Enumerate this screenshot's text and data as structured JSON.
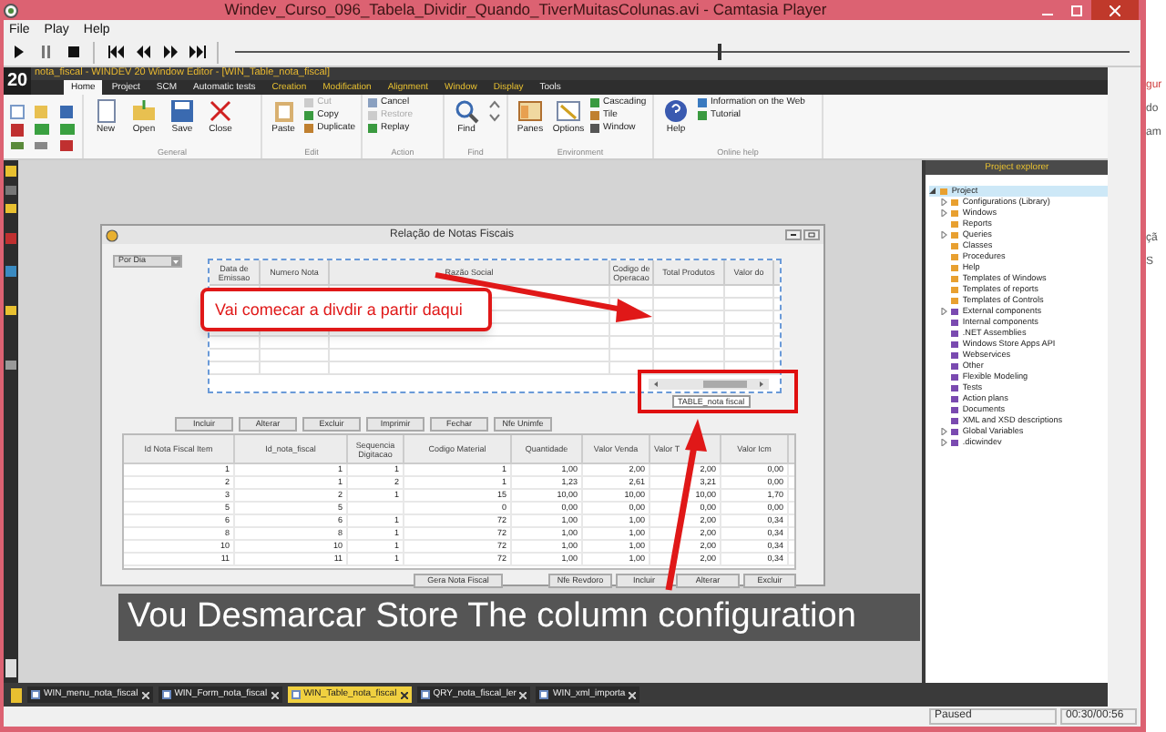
{
  "player": {
    "title": "Windev_Curso_096_Tabela_Dividir_Quando_TiverMuitasColunas.avi - Camtasia Player",
    "menu": [
      "File",
      "Play",
      "Help"
    ],
    "seek": {
      "level": 0.54
    },
    "status": "Paused",
    "time": "00:30/00:56"
  },
  "windev": {
    "logo": "20",
    "title": "nota_fiscal - WINDEV 20  Window Editor - [WIN_Table_nota_fiscal]",
    "tabs": [
      {
        "label": "Home",
        "selected": true,
        "kind": "standard"
      },
      {
        "label": "Project",
        "selected": false,
        "kind": "standard"
      },
      {
        "label": "SCM",
        "selected": false,
        "kind": "standard"
      },
      {
        "label": "Automatic tests",
        "selected": false,
        "kind": "standard"
      },
      {
        "label": "Creation",
        "selected": false,
        "kind": "contextual"
      },
      {
        "label": "Modification",
        "selected": false,
        "kind": "contextual"
      },
      {
        "label": "Alignment",
        "selected": false,
        "kind": "contextual"
      },
      {
        "label": "Window",
        "selected": false,
        "kind": "contextual"
      },
      {
        "label": "Display",
        "selected": false,
        "kind": "contextual"
      },
      {
        "label": "Tools",
        "selected": false,
        "kind": "standard"
      }
    ],
    "ribbon": [
      {
        "group": "General",
        "buttons": [
          {
            "label": "New",
            "kind": "large",
            "disabled": false
          },
          {
            "label": "Open",
            "kind": "large",
            "disabled": false
          },
          {
            "label": "Save",
            "kind": "large",
            "disabled": false
          },
          {
            "label": "Close",
            "kind": "large",
            "disabled": false
          }
        ]
      },
      {
        "group": "Edit",
        "buttons": [
          {
            "label": "Paste",
            "kind": "large",
            "disabled": false
          },
          {
            "label": "Cut",
            "kind": "small",
            "disabled": true
          },
          {
            "label": "Copy",
            "kind": "small",
            "disabled": false
          },
          {
            "label": "Duplicate",
            "kind": "small",
            "disabled": false
          }
        ]
      },
      {
        "group": "Action",
        "buttons": [
          {
            "label": "Cancel",
            "kind": "small",
            "disabled": false
          },
          {
            "label": "Restore",
            "kind": "small",
            "disabled": true
          },
          {
            "label": "Replay",
            "kind": "small",
            "disabled": false
          }
        ]
      },
      {
        "group": "Find",
        "buttons": [
          {
            "label": "Find",
            "kind": "large",
            "disabled": false
          }
        ]
      },
      {
        "group": "Environment",
        "buttons": [
          {
            "label": "Panes",
            "kind": "large",
            "disabled": false
          },
          {
            "label": "Options",
            "kind": "large",
            "disabled": false
          },
          {
            "label": "Cascading",
            "kind": "small",
            "disabled": false
          },
          {
            "label": "Tile",
            "kind": "small",
            "disabled": false
          },
          {
            "label": "Window",
            "kind": "small",
            "disabled": false
          }
        ]
      },
      {
        "group": "Online help",
        "buttons": [
          {
            "label": "Help",
            "kind": "large",
            "disabled": false
          },
          {
            "label": "Information on the Web",
            "kind": "small",
            "disabled": false
          },
          {
            "label": "Tutorial",
            "kind": "small",
            "disabled": false
          }
        ]
      }
    ],
    "explorer": {
      "title": "Project explorer",
      "tree": [
        {
          "label": "Project",
          "selected": true,
          "expanded": true,
          "children": [
            {
              "label": "Configurations (Library)",
              "collapsed": true
            },
            {
              "label": "Windows",
              "collapsed": true
            },
            {
              "label": "Reports",
              "collapsed": false
            },
            {
              "label": "Queries",
              "collapsed": true
            },
            {
              "label": "Classes",
              "collapsed": false
            },
            {
              "label": "Procedures",
              "collapsed": false
            },
            {
              "label": "Help",
              "collapsed": false
            },
            {
              "label": "Templates of Windows",
              "collapsed": false
            },
            {
              "label": "Templates of reports",
              "collapsed": false
            },
            {
              "label": "Templates of Controls",
              "collapsed": false
            },
            {
              "label": "External components",
              "collapsed": true
            },
            {
              "label": "Internal components",
              "collapsed": false
            },
            {
              "label": ".NET Assemblies",
              "collapsed": false
            },
            {
              "label": "Windows Store Apps API",
              "collapsed": false
            },
            {
              "label": "Webservices",
              "collapsed": false
            },
            {
              "label": "Other",
              "collapsed": false
            },
            {
              "label": "Flexible Modeling",
              "collapsed": false
            },
            {
              "label": "Tests",
              "collapsed": false
            },
            {
              "label": "Action plans",
              "collapsed": false
            },
            {
              "label": "Documents",
              "collapsed": false
            },
            {
              "label": "XML and XSD descriptions",
              "collapsed": false
            },
            {
              "label": "Global Variables",
              "collapsed": true
            },
            {
              "label": ".dicwindev",
              "collapsed": true
            }
          ]
        }
      ]
    },
    "editor_window": {
      "title": "Relação de Notas Fiscais",
      "combo": "Por Dia",
      "top_table": {
        "columns": [
          "Data de Emissao",
          "Numero Nota",
          "Razão Social",
          "Codigo de Operacao",
          "Total Produtos",
          "Valor do"
        ]
      },
      "buttons": [
        "Incluir",
        "Alterar",
        "Excluir",
        "Imprimir",
        "Fechar",
        "Nfe Unimfe"
      ],
      "bottom_table": {
        "columns": [
          "Id Nota Fiscal Item",
          "Id_nota_fiscal",
          "Sequencia Digitacao",
          "Codigo Material",
          "Quantidade",
          "Valor Venda",
          "Valor T",
          "Valor Icm"
        ],
        "rows": [
          [
            "1",
            "1",
            "1",
            "1",
            "1,00",
            "2,00",
            "2,00",
            "0,00"
          ],
          [
            "2",
            "1",
            "2",
            "1",
            "1,23",
            "2,61",
            "3,21",
            "0,00"
          ],
          [
            "3",
            "2",
            "1",
            "15",
            "10,00",
            "10,00",
            "10,00",
            "1,70"
          ],
          [
            "5",
            "5",
            "",
            "0",
            "0,00",
            "0,00",
            "0,00",
            "0,00"
          ],
          [
            "6",
            "6",
            "1",
            "72",
            "1,00",
            "1,00",
            "2,00",
            "0,34"
          ],
          [
            "8",
            "8",
            "1",
            "72",
            "1,00",
            "1,00",
            "2,00",
            "0,34"
          ],
          [
            "10",
            "10",
            "1",
            "72",
            "1,00",
            "1,00",
            "2,00",
            "0,34"
          ],
          [
            "11",
            "11",
            "1",
            "72",
            "1,00",
            "1,00",
            "2,00",
            "0,34"
          ]
        ]
      },
      "generate_button": "Gera Nota Fiscal",
      "bottom_buttons": [
        "Nfe Revdoro",
        "Incluir",
        "Alterar",
        "Excluir"
      ]
    },
    "tooltip": "TABLE_nota fiscal",
    "doc_tabs": [
      {
        "label": "WIN_menu_nota_fiscal",
        "selected": false
      },
      {
        "label": "WIN_Form_nota_fiscal",
        "selected": false
      },
      {
        "label": "WIN_Table_nota_fiscal",
        "selected": true
      },
      {
        "label": "QRY_nota_fiscal_ler",
        "selected": false
      },
      {
        "label": "WIN_xml_importa",
        "selected": false
      }
    ]
  },
  "callout": "Vai comecar a divdir a partir daqui",
  "caption": "Vou Desmarcar Store The column configuration",
  "background_texts": [
    "gur",
    "do",
    "am",
    "çã",
    "S"
  ]
}
